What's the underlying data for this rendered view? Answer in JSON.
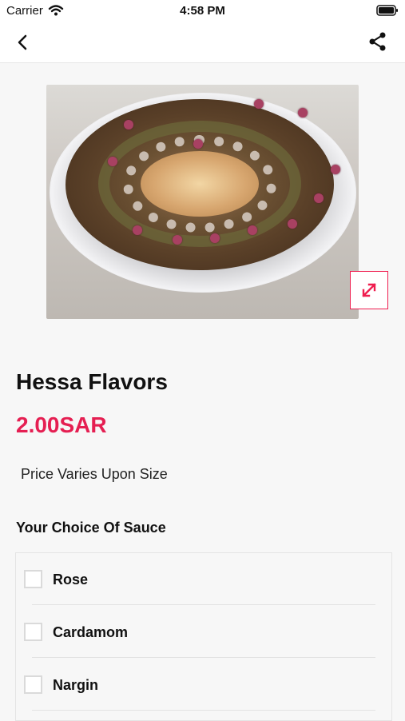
{
  "status_bar": {
    "carrier": "Carrier",
    "time": "4:58 PM",
    "wifi_icon": "wifi-icon",
    "battery_icon": "battery-icon"
  },
  "nav": {
    "back_icon": "chevron-left-icon",
    "share_icon": "share-icon"
  },
  "product": {
    "image_alt": "Hessa Flavors",
    "expand_icon": "expand-icon",
    "title": "Hessa Flavors",
    "price": "2.00SAR",
    "price_note": "Price Varies Upon Size"
  },
  "options": {
    "heading": "Your Choice Of Sauce",
    "items": [
      {
        "label": "Rose",
        "checked": false
      },
      {
        "label": "Cardamom",
        "checked": false
      },
      {
        "label": "Nargin",
        "checked": false
      }
    ]
  },
  "colors": {
    "accent": "#e51f52",
    "background": "#f7f7f7",
    "border": "#e4e4e4"
  }
}
